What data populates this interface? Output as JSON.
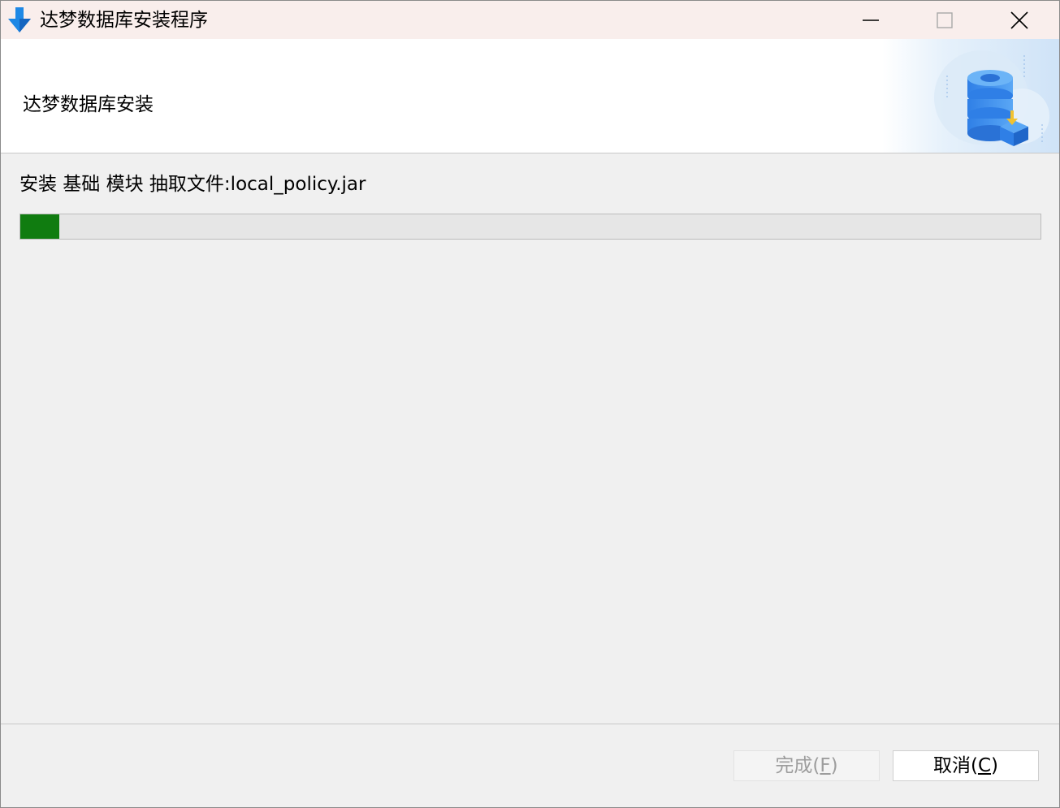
{
  "window": {
    "title": "达梦数据库安装程序",
    "icon": "blue-down-arrow-icon",
    "controls": [
      "minimize-icon",
      "maximize-icon",
      "close-icon"
    ]
  },
  "header": {
    "title": "达梦数据库安装",
    "illustration": "database-install-illustration"
  },
  "progress": {
    "status_text": "安装 基础 模块 抽取文件:local_policy.jar",
    "value": 0.038,
    "fill_color": "#107c10"
  },
  "buttons": {
    "finish": {
      "label_prefix": "完成(",
      "mnemonic": "F",
      "label_suffix": ")",
      "enabled": false
    },
    "cancel": {
      "label_prefix": "取消(",
      "mnemonic": "C",
      "label_suffix": ")",
      "enabled": true
    }
  },
  "colors": {
    "titlebar": "#f9eeec",
    "accent_blue": "#1e88e5"
  }
}
